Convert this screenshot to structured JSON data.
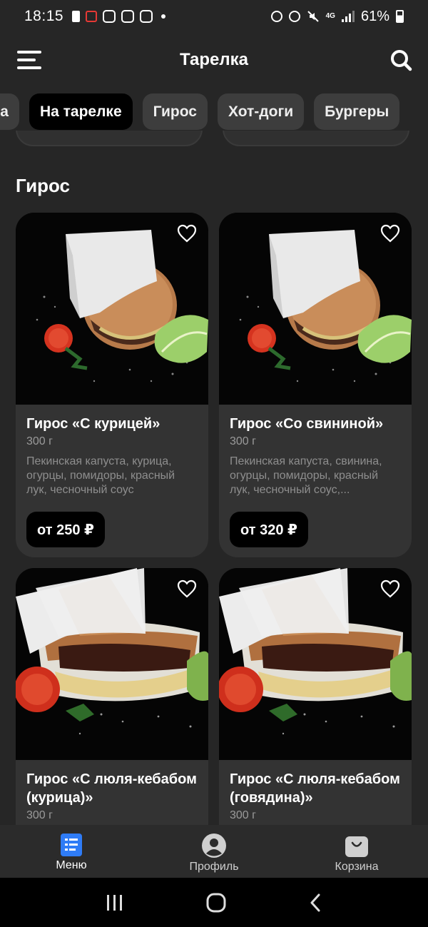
{
  "status_bar": {
    "time": "18:15",
    "battery": "61%",
    "network": "4G"
  },
  "header": {
    "title": "Тарелка"
  },
  "categories": [
    {
      "label": "ма",
      "active": false
    },
    {
      "label": "На тарелке",
      "active": true
    },
    {
      "label": "Гирос",
      "active": false
    },
    {
      "label": "Хот-доги",
      "active": false
    },
    {
      "label": "Бургеры",
      "active": false
    }
  ],
  "section": {
    "title": "Гирос"
  },
  "products": [
    {
      "name": "Гирос «С курицей»",
      "weight": "300 г",
      "description": "Пекинская капуста, курица, огурцы, помидоры, красный лук, чесночный соус",
      "price": "от 250 ₽"
    },
    {
      "name": "Гирос «Со свининой»",
      "weight": "300 г",
      "description": "Пекинская капуста, свинина, огурцы, помидоры, красный лук, чесночный соус,...",
      "price": "от 320 ₽"
    },
    {
      "name": "Гирос «С люля-кебабом (курица)»",
      "weight": "300 г"
    },
    {
      "name": "Гирос «С люля-кебабом (говядина)»",
      "weight": "300 г"
    }
  ],
  "bottom_nav": [
    {
      "label": "Меню",
      "icon": "menu-list-icon",
      "active": true
    },
    {
      "label": "Профиль",
      "icon": "profile-icon",
      "active": false
    },
    {
      "label": "Корзина",
      "icon": "cart-icon",
      "active": false
    }
  ],
  "colors": {
    "background": "#262626",
    "card": "#333333",
    "accent": "#2f7cf6",
    "active_tab": "#000000"
  }
}
